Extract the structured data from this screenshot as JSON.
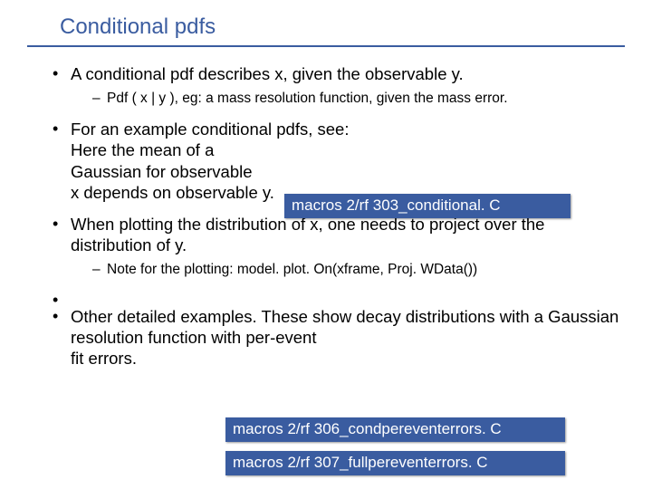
{
  "title": "Conditional pdfs",
  "b1": "A conditional pdf describes x, given the observable y.",
  "b1s1": "Pdf ( x | y ), eg: a mass resolution function, given the mass error.",
  "b2a": "For an example conditional pdfs, see:",
  "b2b": "Here the mean of a",
  "b2c": "Gaussian for observable",
  "b2d": "x depends on observable y.",
  "b3": "When plotting the distribution of x, one needs to project over the distribution of y.",
  "b3s1": "Note for the plotting: model. plot. On(xframe, Proj. WData())",
  "b4a": "Other detailed examples. These show decay distributions with a Gaussian resolution function with per-event",
  "b4b": "fit errors.",
  "macro1": "macros 2/rf 303_conditional. C",
  "macro2": "macros 2/rf 306_condpereventerrors. C",
  "macro3": "macros 2/rf 307_fullpereventerrors. C"
}
